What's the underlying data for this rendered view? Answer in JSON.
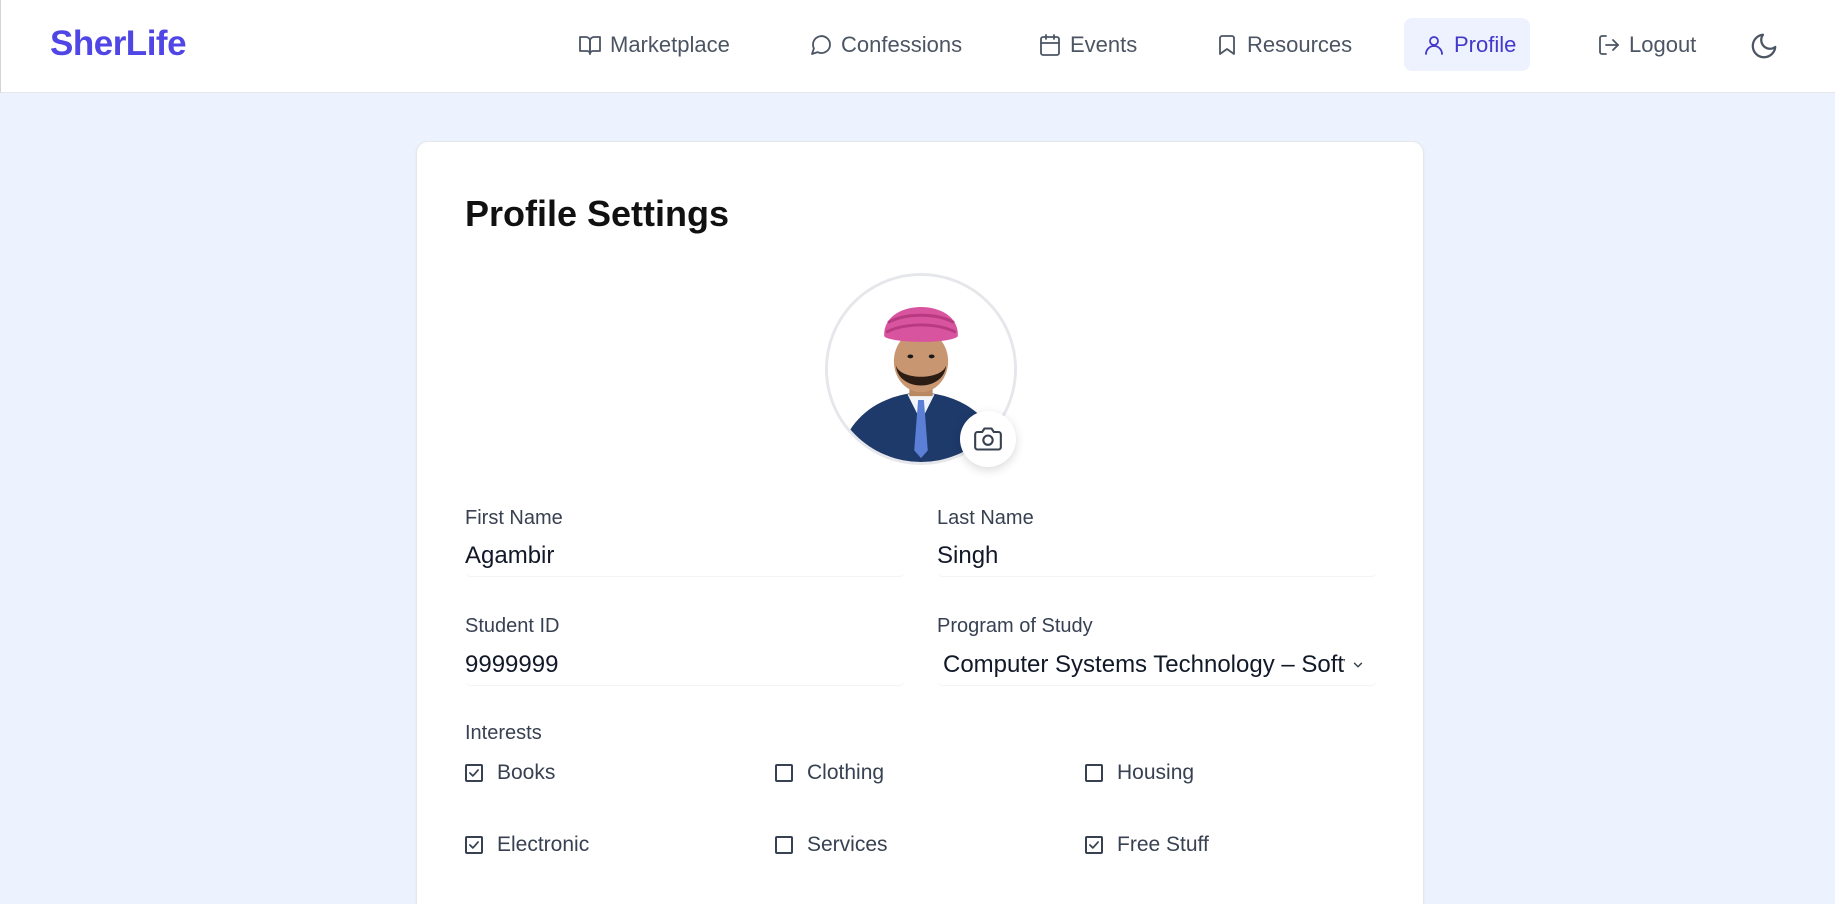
{
  "brand": "SherLife",
  "nav": {
    "marketplace": "Marketplace",
    "confessions": "Confessions",
    "events": "Events",
    "resources": "Resources",
    "profile": "Profile",
    "logout": "Logout"
  },
  "colors": {
    "brand": "#4f46e5",
    "active_bg": "#eef2ff",
    "page_bg": "#edf3fe",
    "turban": "#d9549f",
    "suit": "#1e3a6b"
  },
  "profile": {
    "title": "Profile Settings",
    "first_name_label": "First Name",
    "first_name": "Agambir",
    "last_name_label": "Last Name",
    "last_name": "Singh",
    "student_id_label": "Student ID",
    "student_id": "9999999",
    "program_label": "Program of Study",
    "program": "Computer Systems Technology – Software Development",
    "interests_label": "Interests",
    "interests": [
      {
        "label": "Books",
        "checked": true
      },
      {
        "label": "Clothing",
        "checked": false
      },
      {
        "label": "Housing",
        "checked": false
      },
      {
        "label": "Electronic",
        "checked": true
      },
      {
        "label": "Services",
        "checked": false
      },
      {
        "label": "Free Stuff",
        "checked": true
      }
    ]
  },
  "icons": {
    "marketplace": "book-open-icon",
    "confessions": "chat-bubble-icon",
    "events": "calendar-icon",
    "resources": "bookmark-icon",
    "profile": "user-icon",
    "logout": "logout-icon",
    "theme": "moon-icon",
    "avatar_upload": "camera-icon"
  }
}
